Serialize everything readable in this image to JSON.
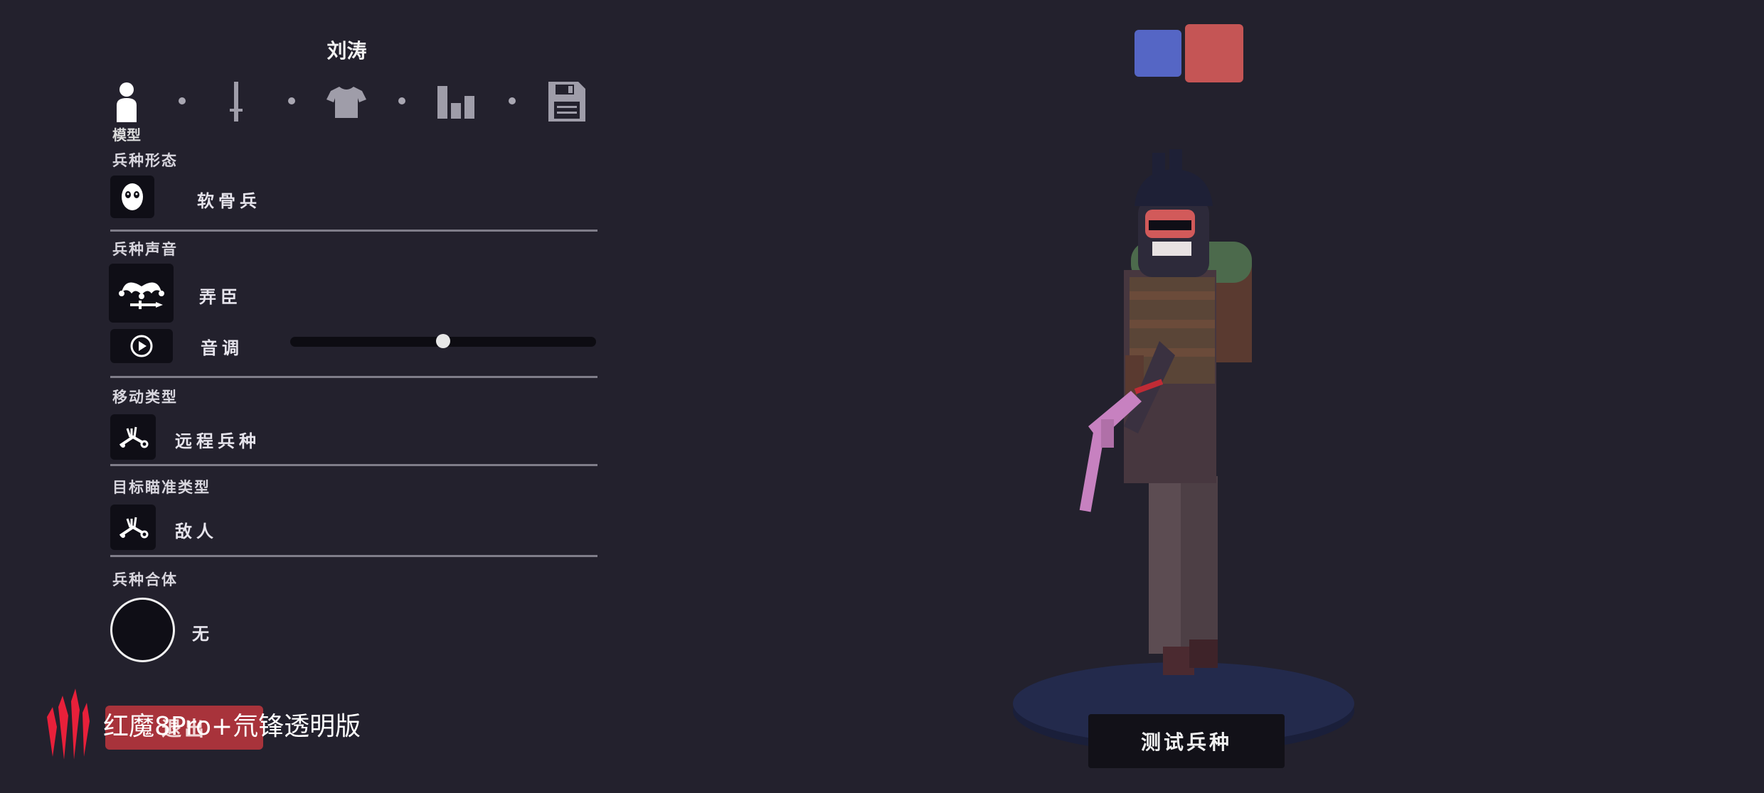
{
  "unit_name": "刘涛",
  "tabs": [
    {
      "name": "model",
      "icon": "person-icon"
    },
    {
      "name": "weapon",
      "icon": "sword-icon"
    },
    {
      "name": "clothing",
      "icon": "shirt-icon"
    },
    {
      "name": "stats",
      "icon": "bar-chart-icon"
    },
    {
      "name": "save",
      "icon": "floppy-disk-icon"
    }
  ],
  "active_tab_label": "模型",
  "sections": {
    "form": {
      "label": "兵种形态",
      "value": "软骨兵",
      "icon": "skull-mask-icon"
    },
    "voice": {
      "label": "兵种声音",
      "value": "弄臣",
      "icon": "jester-hat-icon",
      "pitch_label": "音调",
      "pitch_level": 0.5,
      "play_icon": "play-icon"
    },
    "movement": {
      "label": "移动类型",
      "value": "远程兵种",
      "icon": "ranged-unit-icon"
    },
    "targeting": {
      "label": "目标瞄准类型",
      "value": "敌人",
      "icon": "target-unit-icon"
    },
    "combine": {
      "label": "兵种合体",
      "value": "无"
    }
  },
  "exit_button": "退出",
  "test_button": "测试兵种",
  "watermark": "红魔8Pro+氘锋透明版",
  "team_colors": [
    "#5566c5",
    "#c55555"
  ]
}
